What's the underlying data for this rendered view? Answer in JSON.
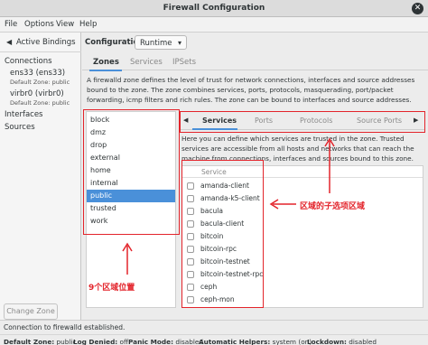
{
  "window": {
    "title": "Firewall Configuration"
  },
  "menu": [
    "File",
    "Options",
    "View",
    "Help"
  ],
  "left": {
    "active_bindings": "Active Bindings",
    "connections": "Connections",
    "conn1_name": "ens33 (ens33)",
    "conn1_zone": "Default Zone: public",
    "conn2_name": "virbr0 (virbr0)",
    "conn2_zone": "Default Zone: public",
    "interfaces": "Interfaces",
    "sources": "Sources",
    "change_zone": "Change Zone"
  },
  "config": {
    "label": "Configuration:",
    "value": "Runtime"
  },
  "top_tabs": [
    "Zones",
    "Services",
    "IPSets"
  ],
  "zone_desc": "A firewalld zone defines the level of trust for network connections, interfaces and source addresses bound to the zone. The zone combines services, ports, protocols, masquerading, port/packet forwarding, icmp filters and rich rules. The zone can be bound to interfaces and source addresses.",
  "zones": [
    "block",
    "dmz",
    "drop",
    "external",
    "home",
    "internal",
    "public",
    "trusted",
    "work"
  ],
  "selected_zone": "public",
  "sub_tabs": [
    "Services",
    "Ports",
    "Protocols",
    "Source Ports"
  ],
  "service_desc": "Here you can define which services are trusted in the zone. Trusted services are accessible from all hosts and networks that can reach the machine from connections, interfaces and sources bound to this zone.",
  "service_header": "Service",
  "services": [
    "amanda-client",
    "amanda-k5-client",
    "bacula",
    "bacula-client",
    "bitcoin",
    "bitcoin-rpc",
    "bitcoin-testnet",
    "bitcoin-testnet-rpc",
    "ceph",
    "ceph-mon"
  ],
  "status": {
    "connection": "Connection to firewalld established.",
    "default_zone_label": "Default Zone:",
    "default_zone": "public",
    "log_denied_label": "Log Denied:",
    "log_denied": "off",
    "panic_label": "Panic Mode:",
    "panic": "disabled",
    "helpers_label": "Automatic Helpers:",
    "helpers": "system (on)",
    "lockdown_label": "Lockdown:",
    "lockdown": "disabled"
  },
  "annotations": {
    "zones_note": "9个区域位置",
    "subtabs_note": "区域的子选项区域"
  },
  "colors": {
    "accent": "#4a90d9",
    "annotation": "#e3242b"
  }
}
